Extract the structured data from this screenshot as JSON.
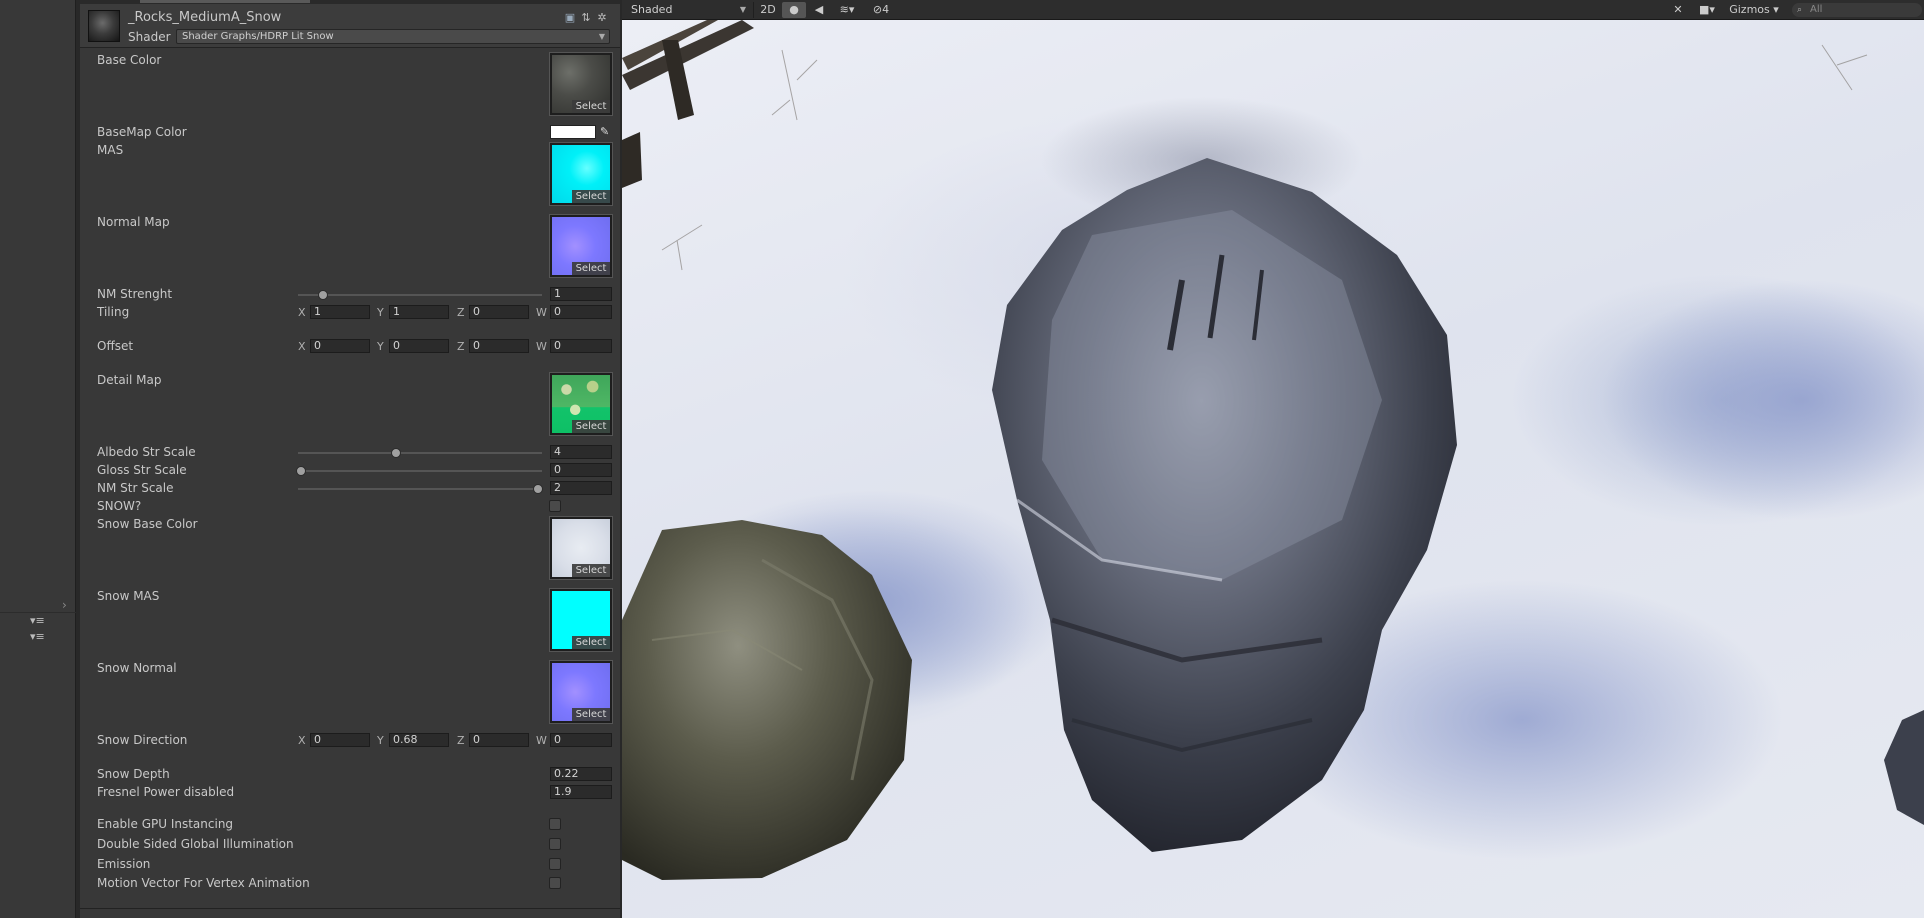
{
  "inspector": {
    "material_name": "_Rocks_MediumA_Snow",
    "shader_label": "Shader",
    "shader_value": "Shader Graphs/HDRP Lit Snow",
    "select_label": "Select",
    "properties": {
      "base_color": "Base Color",
      "basemap_color": "BaseMap Color",
      "mas": "MAS",
      "normal_map": "Normal Map",
      "nm_strength": "NM Strenght",
      "nm_strength_value": "1",
      "tiling": "Tiling",
      "tiling_x": "1",
      "tiling_y": "1",
      "tiling_z": "0",
      "tiling_w": "0",
      "offset": "Offset",
      "offset_x": "0",
      "offset_y": "0",
      "offset_z": "0",
      "offset_w": "0",
      "detail_map": "Detail Map",
      "albedo_str_scale": "Albedo Str Scale",
      "albedo_str_scale_value": "4",
      "gloss_str_scale": "Gloss Str Scale",
      "gloss_str_scale_value": "0",
      "nm_str_scale": "NM Str Scale",
      "nm_str_scale_value": "2",
      "snow_toggle": "SNOW?",
      "snow_base_color": "Snow Base Color",
      "snow_mas": "Snow MAS",
      "snow_normal": "Snow Normal",
      "snow_direction": "Snow Direction",
      "snow_dir_x": "0",
      "snow_dir_y": "0.68",
      "snow_dir_z": "0",
      "snow_dir_w": "0",
      "snow_depth": "Snow Depth",
      "snow_depth_value": "0.22",
      "fresnel_power": "Fresnel Power disabled",
      "fresnel_power_value": "1.9",
      "gpu_instancing": "Enable GPU Instancing",
      "double_sided_gi": "Double Sided Global Illumination",
      "emission": "Emission",
      "motion_vector": "Motion Vector For Vertex Animation"
    },
    "vector_labels": {
      "x": "X",
      "y": "Y",
      "z": "Z",
      "w": "W"
    },
    "colors": {
      "basemap_color": "#ffffff"
    }
  },
  "scene_toolbar": {
    "draw_mode": "Shaded",
    "mode_2d": "2D",
    "effects_count": "4",
    "gizmos": "Gizmos",
    "search_placeholder": "All"
  }
}
